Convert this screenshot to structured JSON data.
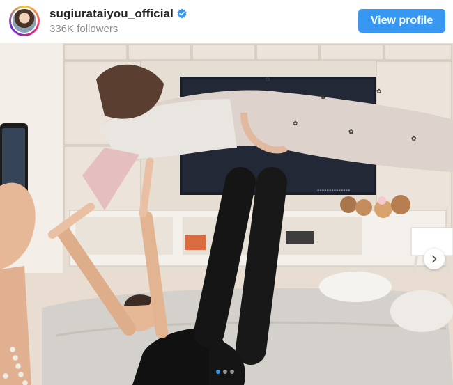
{
  "profile": {
    "username": "sugiurataiyou_official",
    "followers": "336K followers",
    "verified": true,
    "avatar_icon": "profile-avatar"
  },
  "actions": {
    "view_profile_label": "View profile"
  },
  "carousel": {
    "slide_count": 3,
    "active_index": 1,
    "next_icon": "chevron-right-icon"
  },
  "colors": {
    "accent": "#3897f0",
    "text_primary": "#262626",
    "text_secondary": "#8e8e8e"
  }
}
